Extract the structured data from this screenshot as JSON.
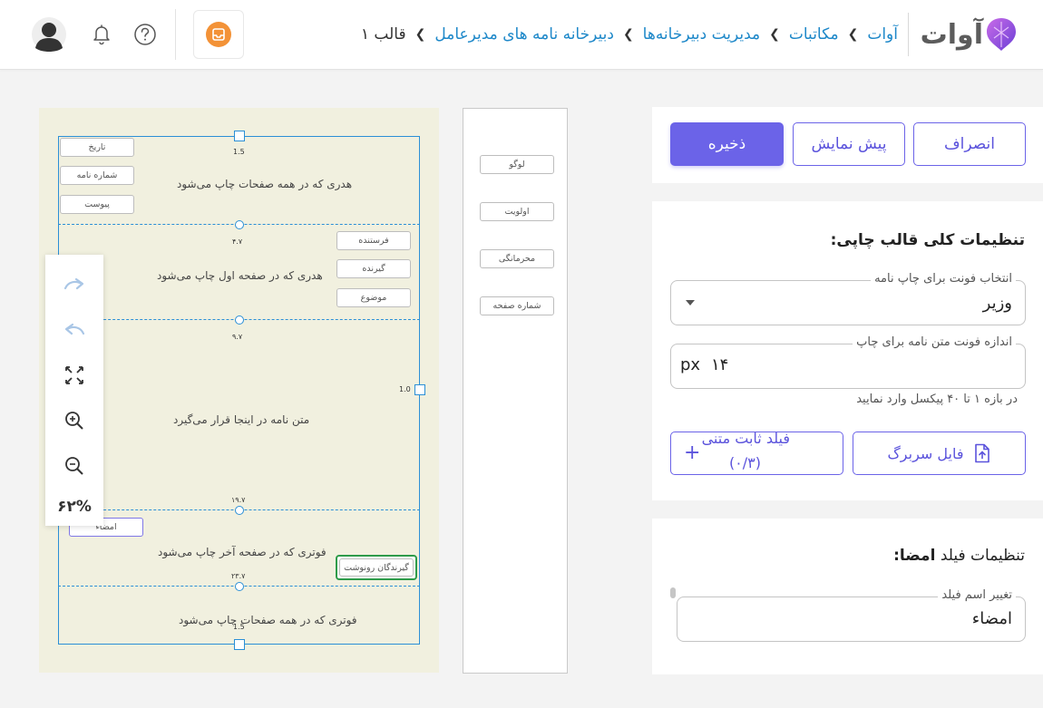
{
  "header": {
    "logo_text": "آوات",
    "breadcrumb": {
      "items": [
        "آوات",
        "مکاتبات",
        "مدیریت دبیرخانه‌ها",
        "دبیرخانه نامه های مدیرعامل"
      ],
      "current": "قالب ۱"
    },
    "icons": [
      "avatar",
      "bell-icon",
      "help-icon",
      "app-icon"
    ]
  },
  "canvas": {
    "regions": {
      "header_all": "هدری که در همه صفحات چاپ می‌شود",
      "header_first": "هدری که در صفحه اول چاپ می‌شود",
      "body": "متن نامه در اینجا قرار می‌گیرد",
      "footer_last": "فوتری که در صفحه آخر چاپ می‌شود",
      "footer_all": "فوتری که در همه صفحات چاپ می‌شود"
    },
    "measures": {
      "top": "1.5",
      "m1": "۴.۷",
      "m2": "۹.۷",
      "right": "1.0",
      "m3": "۱۹.۷",
      "m4": "۲۳.۷",
      "bottom": "1.5"
    },
    "fields": {
      "date": "تاریخ",
      "letter_number": "شماره نامه",
      "attachment": "پیوست",
      "sender": "فرستنده",
      "receiver": "گیرنده",
      "subject": "موضوع",
      "signature": "امضاء",
      "cc_recipients": "گیرندگان رونوشت"
    }
  },
  "zoom": {
    "percent": "۶۲%"
  },
  "palette": {
    "items": [
      "لوگو",
      "اولویت",
      "محرمانگی",
      "شماره صفحه"
    ]
  },
  "actions": {
    "cancel": "انصراف",
    "preview": "پیش نمایش",
    "save": "ذخیره"
  },
  "print_settings": {
    "title": "تنظیمات کلی قالب چاپی:",
    "font_label": "انتخاب فونت برای چاپ نامه",
    "font_value": "وزیر",
    "size_label": "اندازه فونت متن نامه برای چاپ",
    "size_value": "۱۴",
    "size_unit": "px",
    "size_hint": "در بازه ۱ تا ۴۰ پیکسل وارد نمایید",
    "letterhead_button": "فایل سربرگ",
    "fixed_text_button_line1": "فیلد ثابت متنی",
    "fixed_text_button_line2": "(۰/۳)"
  },
  "field_settings": {
    "title_prefix": "تنظیمات فیلد",
    "title_field": "امضا",
    "title_suffix": ":",
    "name_label": "تغییر اسم فیلد",
    "name_value": "امضاء"
  },
  "colors": {
    "accent": "#6b63e8",
    "link": "#1e88c9",
    "canvas_bg": "#f1f0df",
    "guide": "#2b8fd6",
    "selected": "#2e9b4a",
    "app_icon": "#f39237"
  }
}
